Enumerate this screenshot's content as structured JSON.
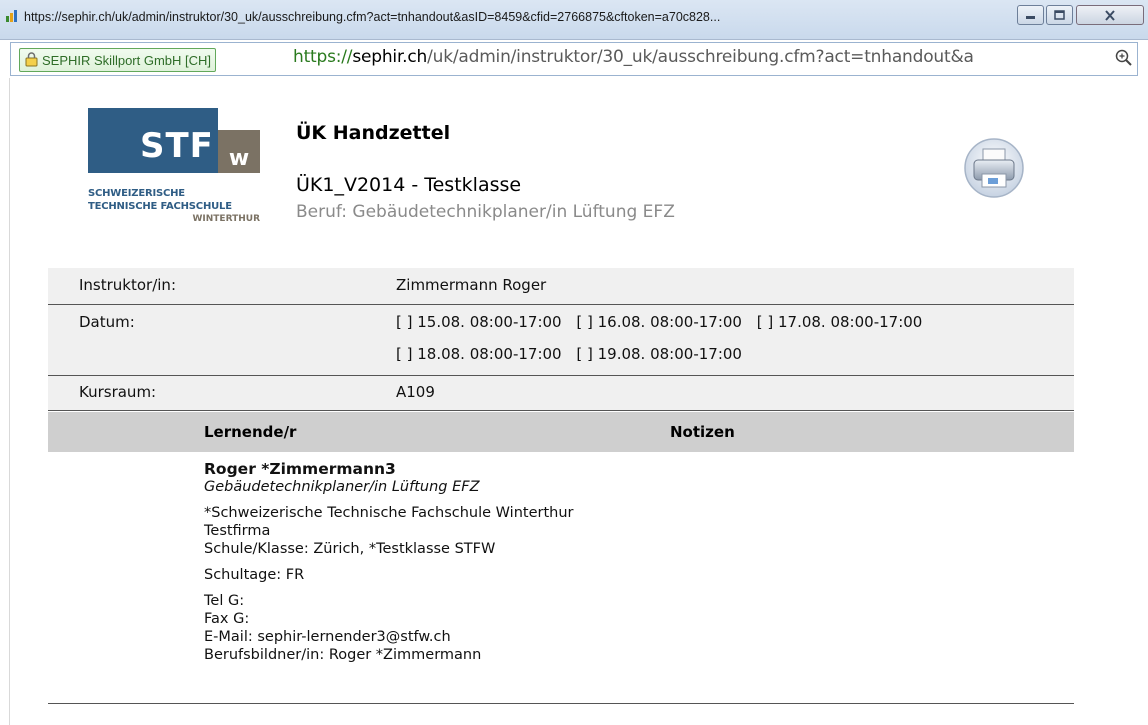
{
  "window": {
    "title": "https://sephir.ch/uk/admin/instruktor/30_uk/ausschreibung.cfm?act=tnhandout&asID=8459&cfid=2766875&cftoken=a70c828..."
  },
  "addressbar": {
    "site_identity": "SEPHIR Skillport GmbH [CH]",
    "url_scheme": "https://",
    "url_host": "sephir.ch",
    "url_path": "/uk/admin/instruktor/30_uk/ausschreibung.cfm?act=tnhandout&a"
  },
  "logo": {
    "mark": "STF",
    "mark2": "w",
    "line1": "SCHWEIZERISCHE",
    "line2": "TECHNISCHE FACHSCHULE",
    "line3": "WINTERTHUR"
  },
  "header": {
    "title": "ÜK Handzettel",
    "class_name": "ÜK1_V2014 - Testklasse",
    "beruf": "Beruf: Gebäudetechnikplaner/in Lüftung EFZ"
  },
  "info": {
    "instruktor_label": "Instruktor/in:",
    "instruktor_value": "Zimmermann Roger",
    "datum_label": "Datum:",
    "dates_line1": [
      "[ ] 15.08. 08:00-17:00",
      "[ ] 16.08. 08:00-17:00",
      "[ ] 17.08. 08:00-17:00"
    ],
    "dates_line2": [
      "[ ] 18.08. 08:00-17:00",
      "[ ] 19.08. 08:00-17:00"
    ],
    "kursraum_label": "Kursraum:",
    "kursraum_value": "A109"
  },
  "table": {
    "col_lernende": "Lernende/r",
    "col_notizen": "Notizen",
    "entries": [
      {
        "name": "Roger *Zimmermann3",
        "beruf": "Gebäudetechnikplaner/in Lüftung EFZ",
        "school": "*Schweizerische Technische Fachschule Winterthur",
        "company": "Testfirma",
        "schule_klasse": "Schule/Klasse: Zürich, *Testklasse STFW",
        "schultage": "Schultage: FR",
        "tel": "Tel G:",
        "fax": "Fax G:",
        "email": "E-Mail: sephir-lernender3@stfw.ch",
        "berufsbildner": "Berufsbildner/in: Roger *Zimmermann"
      }
    ]
  },
  "colors": {
    "logo_blue": "#2f5d85",
    "logo_taupe": "#7b7264",
    "row_bg": "#f0f0f0",
    "header_bg": "#cfcfcf"
  }
}
